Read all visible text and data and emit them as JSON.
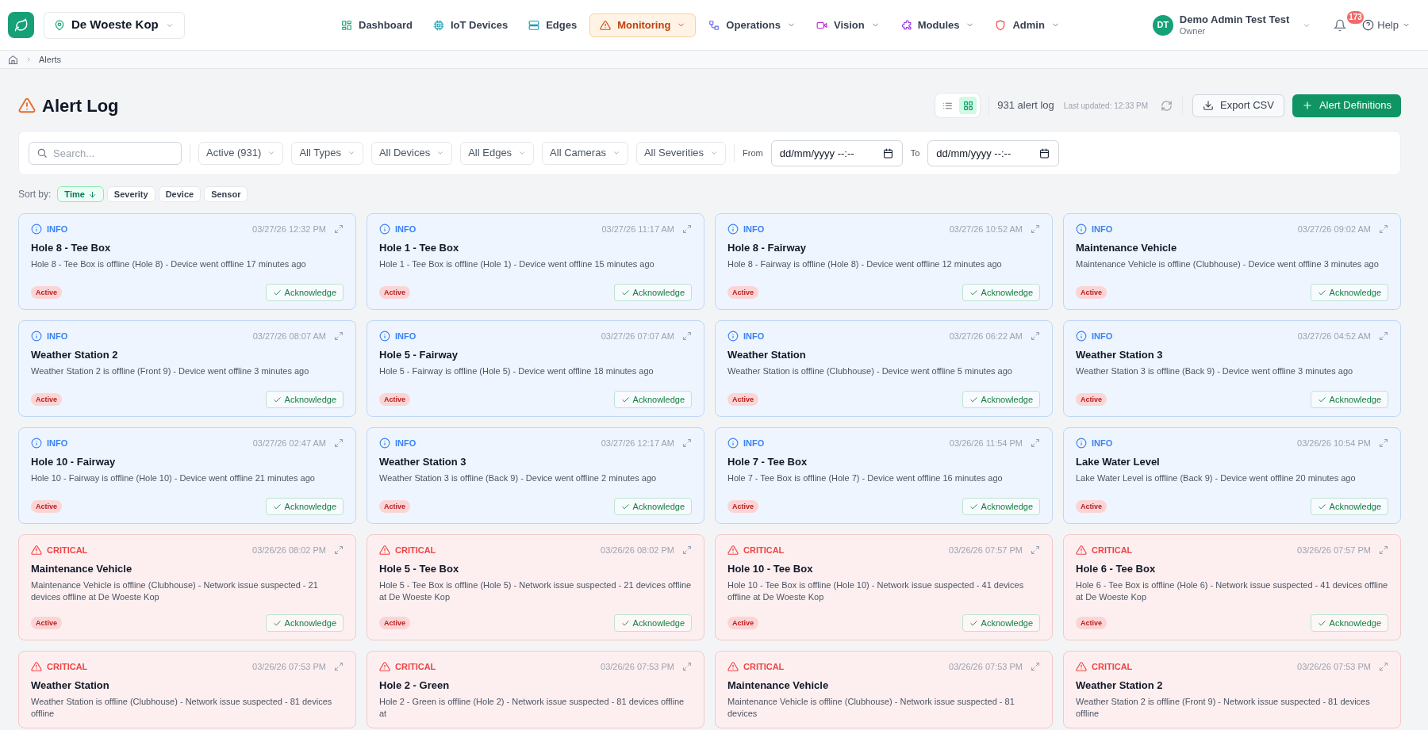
{
  "brand": {
    "location": "De Woeste Kop"
  },
  "nav": [
    {
      "label": "Dashboard",
      "kind": "grid",
      "selected": false,
      "dropdown": false
    },
    {
      "label": "IoT Devices",
      "kind": "chip",
      "selected": false,
      "dropdown": false
    },
    {
      "label": "Edges",
      "kind": "server",
      "selected": false,
      "dropdown": false
    },
    {
      "label": "Monitoring",
      "kind": "warning",
      "selected": true,
      "dropdown": true
    },
    {
      "label": "Operations",
      "kind": "flow",
      "selected": false,
      "dropdown": true
    },
    {
      "label": "Vision",
      "kind": "video",
      "selected": false,
      "dropdown": true
    },
    {
      "label": "Modules",
      "kind": "puzzle",
      "selected": false,
      "dropdown": true
    },
    {
      "label": "Admin",
      "kind": "shield",
      "selected": false,
      "dropdown": true
    }
  ],
  "user": {
    "initials": "DT",
    "name": "Demo Admin Test Test",
    "role": "Owner"
  },
  "notifications": {
    "count": "173"
  },
  "help": {
    "label": "Help"
  },
  "breadcrumb": [
    "Alerts"
  ],
  "page": {
    "title": "Alert Log",
    "count": "931 alert log",
    "last_updated": "Last updated: 12:33 PM",
    "export_label": "Export CSV",
    "primary_label": "Alert Definitions"
  },
  "view_toggle": [
    {
      "kind": "list",
      "selected": false
    },
    {
      "kind": "grid",
      "selected": true
    }
  ],
  "filters": {
    "search_placeholder": "Search...",
    "dropdowns": [
      "Active (931)",
      "All Types",
      "All Devices",
      "All Edges",
      "All Cameras",
      "All Severities"
    ],
    "from_label": "From",
    "from_placeholder": "dd/mm/yyyy --:--",
    "to_label": "To",
    "to_placeholder": "dd/mm/yyyy --:--"
  },
  "sort": {
    "label": "Sort by:",
    "options": [
      {
        "label": "Time",
        "selected": true
      },
      {
        "label": "Severity",
        "selected": false
      },
      {
        "label": "Device",
        "selected": false
      },
      {
        "label": "Sensor",
        "selected": false
      }
    ]
  },
  "alerts": [
    {
      "kind": "info",
      "level_label": "INFO",
      "time": "03/27/26 12:32 PM",
      "title": "Hole 8 - Tee Box",
      "message": "Hole 8 - Tee Box is offline (Hole 8) - Device went offline 17 minutes ago",
      "status": "Active",
      "action": "Acknowledge"
    },
    {
      "kind": "info",
      "level_label": "INFO",
      "time": "03/27/26 11:17 AM",
      "title": "Hole 1 - Tee Box",
      "message": "Hole 1 - Tee Box is offline (Hole 1) - Device went offline 15 minutes ago",
      "status": "Active",
      "action": "Acknowledge"
    },
    {
      "kind": "info",
      "level_label": "INFO",
      "time": "03/27/26 10:52 AM",
      "title": "Hole 8 - Fairway",
      "message": "Hole 8 - Fairway is offline (Hole 8) - Device went offline 12 minutes ago",
      "status": "Active",
      "action": "Acknowledge"
    },
    {
      "kind": "info",
      "level_label": "INFO",
      "time": "03/27/26 09:02 AM",
      "title": "Maintenance Vehicle",
      "message": "Maintenance Vehicle is offline (Clubhouse) - Device went offline 3 minutes ago",
      "status": "Active",
      "action": "Acknowledge"
    },
    {
      "kind": "info",
      "level_label": "INFO",
      "time": "03/27/26 08:07 AM",
      "title": "Weather Station 2",
      "message": "Weather Station 2 is offline (Front 9) - Device went offline 3 minutes ago",
      "status": "Active",
      "action": "Acknowledge"
    },
    {
      "kind": "info",
      "level_label": "INFO",
      "time": "03/27/26 07:07 AM",
      "title": "Hole 5 - Fairway",
      "message": "Hole 5 - Fairway is offline (Hole 5) - Device went offline 18 minutes ago",
      "status": "Active",
      "action": "Acknowledge"
    },
    {
      "kind": "info",
      "level_label": "INFO",
      "time": "03/27/26 06:22 AM",
      "title": "Weather Station",
      "message": "Weather Station is offline (Clubhouse) - Device went offline 5 minutes ago",
      "status": "Active",
      "action": "Acknowledge"
    },
    {
      "kind": "info",
      "level_label": "INFO",
      "time": "03/27/26 04:52 AM",
      "title": "Weather Station 3",
      "message": "Weather Station 3 is offline (Back 9) - Device went offline 3 minutes ago",
      "status": "Active",
      "action": "Acknowledge"
    },
    {
      "kind": "info",
      "level_label": "INFO",
      "time": "03/27/26 02:47 AM",
      "title": "Hole 10 - Fairway",
      "message": "Hole 10 - Fairway is offline (Hole 10) - Device went offline 21 minutes ago",
      "status": "Active",
      "action": "Acknowledge"
    },
    {
      "kind": "info",
      "level_label": "INFO",
      "time": "03/27/26 12:17 AM",
      "title": "Weather Station 3",
      "message": "Weather Station 3 is offline (Back 9) - Device went offline 2 minutes ago",
      "status": "Active",
      "action": "Acknowledge"
    },
    {
      "kind": "info",
      "level_label": "INFO",
      "time": "03/26/26 11:54 PM",
      "title": "Hole 7 - Tee Box",
      "message": "Hole 7 - Tee Box is offline (Hole 7) - Device went offline 16 minutes ago",
      "status": "Active",
      "action": "Acknowledge"
    },
    {
      "kind": "info",
      "level_label": "INFO",
      "time": "03/26/26 10:54 PM",
      "title": "Lake Water Level",
      "message": "Lake Water Level is offline (Back 9) - Device went offline 20 minutes ago",
      "status": "Active",
      "action": "Acknowledge"
    },
    {
      "kind": "critical",
      "level_label": "CRITICAL",
      "time": "03/26/26 08:02 PM",
      "title": "Maintenance Vehicle",
      "message": "Maintenance Vehicle is offline (Clubhouse) - Network issue suspected - 21 devices offline at De Woeste Kop",
      "status": "Active",
      "action": "Acknowledge"
    },
    {
      "kind": "critical",
      "level_label": "CRITICAL",
      "time": "03/26/26 08:02 PM",
      "title": "Hole 5 - Tee Box",
      "message": "Hole 5 - Tee Box is offline (Hole 5) - Network issue suspected - 21 devices offline at De Woeste Kop",
      "status": "Active",
      "action": "Acknowledge"
    },
    {
      "kind": "critical",
      "level_label": "CRITICAL",
      "time": "03/26/26 07:57 PM",
      "title": "Hole 10 - Tee Box",
      "message": "Hole 10 - Tee Box is offline (Hole 10) - Network issue suspected - 41 devices offline at De Woeste Kop",
      "status": "Active",
      "action": "Acknowledge"
    },
    {
      "kind": "critical",
      "level_label": "CRITICAL",
      "time": "03/26/26 07:57 PM",
      "title": "Hole 6 - Tee Box",
      "message": "Hole 6 - Tee Box is offline (Hole 6) - Network issue suspected - 41 devices offline at De Woeste Kop",
      "status": "Active",
      "action": "Acknowledge"
    },
    {
      "kind": "critical",
      "level_label": "CRITICAL",
      "time": "03/26/26 07:53 PM",
      "title": "Weather Station",
      "message": "Weather Station is offline (Clubhouse) - Network issue suspected - 81 devices offline"
    },
    {
      "kind": "critical",
      "level_label": "CRITICAL",
      "time": "03/26/26 07:53 PM",
      "title": "Hole 2 - Green",
      "message": "Hole 2 - Green is offline (Hole 2) - Network issue suspected - 81 devices offline at"
    },
    {
      "kind": "critical",
      "level_label": "CRITICAL",
      "time": "03/26/26 07:53 PM",
      "title": "Maintenance Vehicle",
      "message": "Maintenance Vehicle is offline (Clubhouse) - Network issue suspected - 81 devices"
    },
    {
      "kind": "critical",
      "level_label": "CRITICAL",
      "time": "03/26/26 07:53 PM",
      "title": "Weather Station 2",
      "message": "Weather Station 2 is offline (Front 9) - Network issue suspected - 81 devices offline"
    }
  ]
}
